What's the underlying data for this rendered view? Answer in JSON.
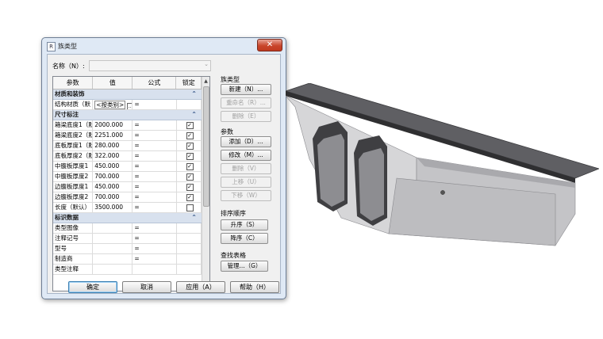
{
  "dialog": {
    "title": "族类型",
    "name_label": "名称（N）:",
    "name_value": "",
    "table": {
      "headers": [
        "参数",
        "值",
        "公式",
        "锁定"
      ],
      "groups": [
        {
          "title": "材质和装饰",
          "rows": [
            {
              "param": "结构材质（默",
              "value": "<按类别>",
              "formula": "=",
              "locked": null,
              "value_is_select": true
            }
          ]
        },
        {
          "title": "尺寸标注",
          "rows": [
            {
              "param": "箱梁底度1（默",
              "value": "2000.000",
              "formula": "=",
              "locked": true
            },
            {
              "param": "箱梁底度2（默",
              "value": "2251.000",
              "formula": "=",
              "locked": true
            },
            {
              "param": "底板厚度1（默",
              "value": "280.000",
              "formula": "=",
              "locked": true
            },
            {
              "param": "底板厚度2（默",
              "value": "322.000",
              "formula": "=",
              "locked": true
            },
            {
              "param": "中腹板厚度1（",
              "value": "450.000",
              "formula": "=",
              "locked": true
            },
            {
              "param": "中腹板厚度2（",
              "value": "700.000",
              "formula": "=",
              "locked": true
            },
            {
              "param": "边腹板厚度1（",
              "value": "450.000",
              "formula": "=",
              "locked": true
            },
            {
              "param": "边腹板厚度2（",
              "value": "700.000",
              "formula": "=",
              "locked": true
            },
            {
              "param": "长度（默认）",
              "value": "3500.000",
              "formula": "=",
              "locked": false
            }
          ]
        },
        {
          "title": "标识数据",
          "rows": [
            {
              "param": "类型图像",
              "value": "",
              "formula": "=",
              "locked": null
            },
            {
              "param": "注释记号",
              "value": "",
              "formula": "=",
              "locked": null
            },
            {
              "param": "型号",
              "value": "",
              "formula": "=",
              "locked": null
            },
            {
              "param": "制造商",
              "value": "",
              "formula": "=",
              "locked": null
            },
            {
              "param": "类型注释",
              "value": "",
              "formula": "",
              "locked": null
            }
          ]
        }
      ]
    },
    "family_types": {
      "label": "族类型",
      "new": "新建（N）...",
      "rename": "重命名（R）...",
      "delete": "删除（E）"
    },
    "parameters": {
      "label": "参数",
      "add": "添加（D）...",
      "modify": "修改（M）...",
      "remove": "删除（V）",
      "move_up": "上移（U）",
      "move_down": "下移（W）"
    },
    "sort_order": {
      "label": "排序顺序",
      "ascending": "升序（S）",
      "descending": "降序（C）"
    },
    "lookup_tables": {
      "label": "查找表格",
      "manage": "管理...（G）"
    },
    "footer": {
      "ok": "确定",
      "cancel": "取消",
      "apply": "应用（A）",
      "help": "帮助（H）"
    },
    "close_glyph": "✕"
  },
  "colors": {
    "window_frame": "#dfe9f5",
    "group_header": "#d8e1ee",
    "girder_top": "#5f5f63",
    "girder_side": "#d4d4d6",
    "girder_front": "#bdbdc0"
  }
}
